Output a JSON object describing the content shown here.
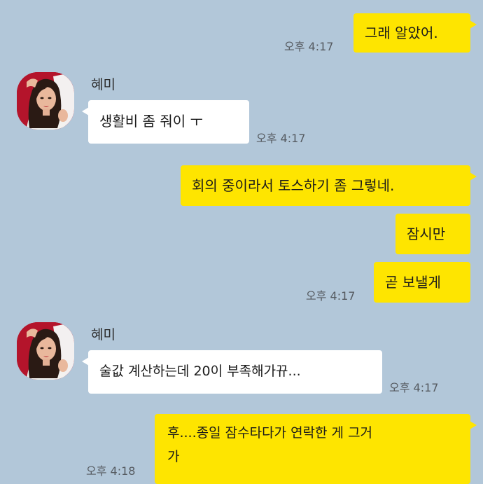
{
  "messages": [
    {
      "from": "me",
      "text": "그래 알았어.",
      "time": "오후 4:17"
    },
    {
      "from": "other",
      "sender": "혜미",
      "text": "생활비 좀 줘이 ㅜ",
      "time": "오후 4:17"
    },
    {
      "from": "me",
      "text": "회의 중이라서 토스하기 좀 그렇네."
    },
    {
      "from": "me",
      "text": "잠시만"
    },
    {
      "from": "me",
      "text": "곧 보낼게",
      "time": "오후 4:17"
    },
    {
      "from": "other",
      "sender": "혜미",
      "text": "술값 계산하는데 20이 부족해가뀨...",
      "time": "오후 4:17"
    },
    {
      "from": "me",
      "text_line1": "후....종일 잠수타다가 연락한 게 그거",
      "text_line2": "가",
      "time": "오후 4:18"
    }
  ],
  "colors": {
    "background": "#b2c7d9",
    "my_bubble": "#fee500",
    "other_bubble": "#ffffff",
    "avatar_bg": "#b4142b"
  },
  "icons": {
    "avatar": "profile-photo-avatar"
  }
}
